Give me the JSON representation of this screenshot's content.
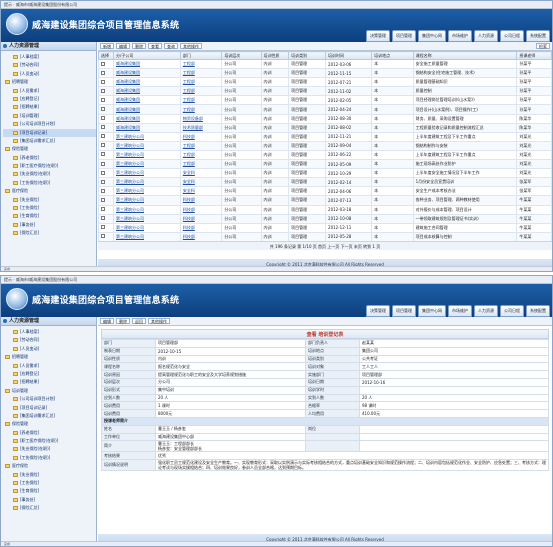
{
  "window": {
    "title": "提示 · 威海市/威海建设集团股份有限公司"
  },
  "app": {
    "title": "威海建设集团综合项目管理信息系统"
  },
  "topnav": [
    "决策管理",
    "项目管理",
    "集团中心网",
    "市场维护",
    "人力资源",
    "公司日程",
    "系统配置"
  ],
  "sidebar": {
    "header": "人力资源管理",
    "items": [
      "[人事档案]",
      "[劳动合同]",
      "[人员变动]",
      "招聘管理",
      "[人员需求]",
      "[应聘登记]",
      "[招聘结果]",
      "[培训管理]",
      "[公司培训项目计划]",
      "[项目培训记录]",
      "[集团培训需求汇总]",
      "保险管理",
      "[养老保险]",
      "[职工医疗保险(在职)]",
      "[失业保险(在职)]",
      "[工伤保险(在职)]",
      "医疗保险",
      "[失业保险]",
      "[工伤保险]",
      "[生育保险]",
      "[事务处]",
      "[保险汇总]"
    ],
    "items2": [
      "[人事档案]",
      "[劳动合同]",
      "[人员变动]",
      "招聘管理",
      "[人员需求]",
      "[应聘登记]",
      "[招聘结果]",
      "培训管理",
      "[公司培训项目计划]",
      "[项目培训记录]",
      "[集团培训需求汇总]",
      "保险管理",
      "[养老保险]",
      "[职工医疗保险(在职)]",
      "[失业保险(在职)]",
      "[工伤保险(在职)]",
      "医疗保险",
      "[失业保险]",
      "[工伤保险]",
      "[生育保险]",
      "[事务处]",
      "[保险汇总]"
    ]
  },
  "toolbar": [
    "新增",
    "编辑",
    "删除",
    "查看",
    "查询",
    "其他操作"
  ],
  "toolbar_right": "检索",
  "grid": {
    "columns": [
      "选择",
      "分/子公司",
      "部门",
      "培训层次",
      "培训性质",
      "培训类别",
      "培训时间",
      "培训地点",
      "课程名称",
      "授课老师"
    ],
    "rows": [
      [
        "威海建设集团",
        "工程部",
        "分公司",
        "内训",
        "项目管理",
        "2012-03-06",
        "本",
        "安全施工质量管理",
        "孙某平"
      ],
      [
        "威海建设集团",
        "工程部",
        "分公司",
        "内训",
        "项目管理",
        "2012-11-15",
        "本",
        "钢结构安全(住宅施工管理、技术)",
        "孙某平"
      ],
      [
        "威海建设集团",
        "工程部",
        "分公司",
        "内训",
        "项目管理",
        "2012-07-21",
        "本",
        "质量管理基础知识",
        "孙某平"
      ],
      [
        "威海建设集团",
        "工程部",
        "分公司",
        "内训",
        "项目管理",
        "2012-11-02",
        "本",
        "质量控制",
        "孙某平"
      ],
      [
        "威海建设集团",
        "工程部",
        "分公司",
        "内训",
        "项目管理",
        "2012-02-05",
        "本",
        "项目经理岗位管理培训(《山水案》)",
        "孙某平"
      ],
      [
        "威海建设集团",
        "工程部",
        "分公司",
        "内训",
        "项目管理",
        "2012-04-24",
        "本",
        "项目设计(山水案例)、项目操作(工)",
        "孙某平"
      ],
      [
        "威海建设集团",
        "物资设备部",
        "分公司",
        "内训",
        "项目管理",
        "2012-08-30",
        "本",
        "财务、质量、采购设置管理",
        "陈某华"
      ],
      [
        "威海建设集团",
        "技术质量部",
        "分公司",
        "内训",
        "项目管理",
        "2012-08-02",
        "本",
        "工程质量验收记录和质量控制流程汇总",
        "陈某华"
      ],
      [
        "第三建筑分公司",
        "科技部",
        "分公司",
        "内训",
        "项目管理",
        "2012-11-21",
        "本",
        "上半年度建筑工程及下半工作重点",
        "刘某光"
      ],
      [
        "第三建筑分公司",
        "工程部",
        "分公司",
        "内训",
        "项目管理",
        "2012-09-04",
        "本",
        "钢结构制作与安装",
        "刘某光"
      ],
      [
        "第三建筑分公司",
        "工程部",
        "分公司",
        "内训",
        "项目管理",
        "2012-06-22",
        "本",
        "上半年度建筑工程及下半工作重点",
        "刘某光"
      ],
      [
        "第三建筑分公司",
        "工程部",
        "分公司",
        "内训",
        "项目管理",
        "2012-05-09",
        "本",
        "施工现场高处作业防护",
        "刘某光"
      ],
      [
        "第三建筑分公司",
        "安全科",
        "分公司",
        "内训",
        "项目管理",
        "2012-10-29",
        "本",
        "上半年度安全施工情况及下半年工作",
        "刘某光"
      ],
      [
        "第三建筑分公司",
        "安全科",
        "分公司",
        "内训",
        "项目管理",
        "2012-02-14",
        "本",
        "1月份安全员宣贯培训",
        "张某军"
      ],
      [
        "第三建筑分公司",
        "安全科",
        "分公司",
        "内训",
        "项目管理",
        "2012-04-06",
        "本",
        "安全生产成本考核办法",
        "张某军"
      ],
      [
        "第三建筑分公司",
        "科技部",
        "分公司",
        "内训",
        "项目管理",
        "2012-07-13",
        "本",
        "各种业务、项目管理、两种教材使用",
        "牛某某"
      ],
      [
        "第三建筑分公司",
        "科技部",
        "分公司",
        "内训",
        "项目管理",
        "2012-03-18",
        "本",
        "对外报价与成本管理、项目设计",
        "牛某某"
      ],
      [
        "第三建筑分公司",
        "科技部",
        "分公司",
        "内训",
        "项目管理",
        "2012-10-08",
        "本",
        "一带领取建筑规划及管理证书(实训)",
        "牛某某"
      ],
      [
        "第三建筑分公司",
        "科技部",
        "分公司",
        "内训",
        "项目管理",
        "2012-12-11",
        "本",
        "建筑施工合同管理",
        "牛某某"
      ],
      [
        "第三建筑分公司",
        "科技部",
        "分公司",
        "内训",
        "项目管理",
        "2012-05-28",
        "本",
        "项目成本核算与控制",
        "牛某某"
      ]
    ]
  },
  "pager": "共 196 条记录  第 1/10 页  首页  上一页  下一页  末页  转到 1 页",
  "footer": "Copyright © 2011 北京满科软件有限公司 All Rights Reserved",
  "status": "完成",
  "detail": {
    "toolbar": [
      "编辑",
      "删除",
      "返回",
      "其他操作"
    ],
    "title": "查看 培训登记表",
    "fields": [
      [
        "部门",
        "项目管理部",
        "部门负责人",
        "赵某某"
      ],
      [
        "制表日期",
        "2012-10-15",
        "培训地点",
        "集团公司"
      ],
      [
        "培训性质",
        "内训",
        "培训类别",
        "公共考证"
      ],
      [
        "课程名称",
        "报名规范化与安全",
        "培训对象",
        "工人工人"
      ],
      [
        "培训原因",
        "提高管理规范化与职工的安全及大学培养规划措施",
        "实施部门",
        "项目管理部"
      ],
      [
        "培训层次",
        "分公司",
        "培训日期",
        "2012-10-16"
      ],
      [
        "培训形式",
        "集中培训",
        "培训学时",
        ""
      ],
      [
        "应到人数",
        "20 人",
        "实到人数",
        "20 人"
      ],
      [
        "培训费用",
        "1 课时",
        "合格率",
        "98 课时"
      ],
      [
        "培训费用",
        "8000元",
        "人均费用",
        "410.00元"
      ]
    ],
    "section_teacher": "授课老师简介",
    "teacher": [
      [
        "姓名",
        "曹玉玉 / 杨彦玺",
        "岗位",
        ""
      ],
      [
        "工作单位",
        "威海建设集团中心部",
        "",
        ""
      ],
      [
        "简介",
        "曹玉玉：工程部部长\n杨彦玺：安全管理部部长",
        "",
        ""
      ]
    ],
    "assessment_label": "考核结果",
    "assessment": "优秀",
    "summary_label": "培训情况说明",
    "summary": "强化职工员工规范化建设及安全生产教育。一、实现教育形式：采取以实例演示与实际考核相结合的方式，重点培训基础安全知识和规范操作流程；二、培训内容包括规范化作业、安全防护、应急处置；三、考核方式：理论考试与现场实操相结合；四、培训效果良好，参训人员全部合格，达到预期目标。"
  }
}
